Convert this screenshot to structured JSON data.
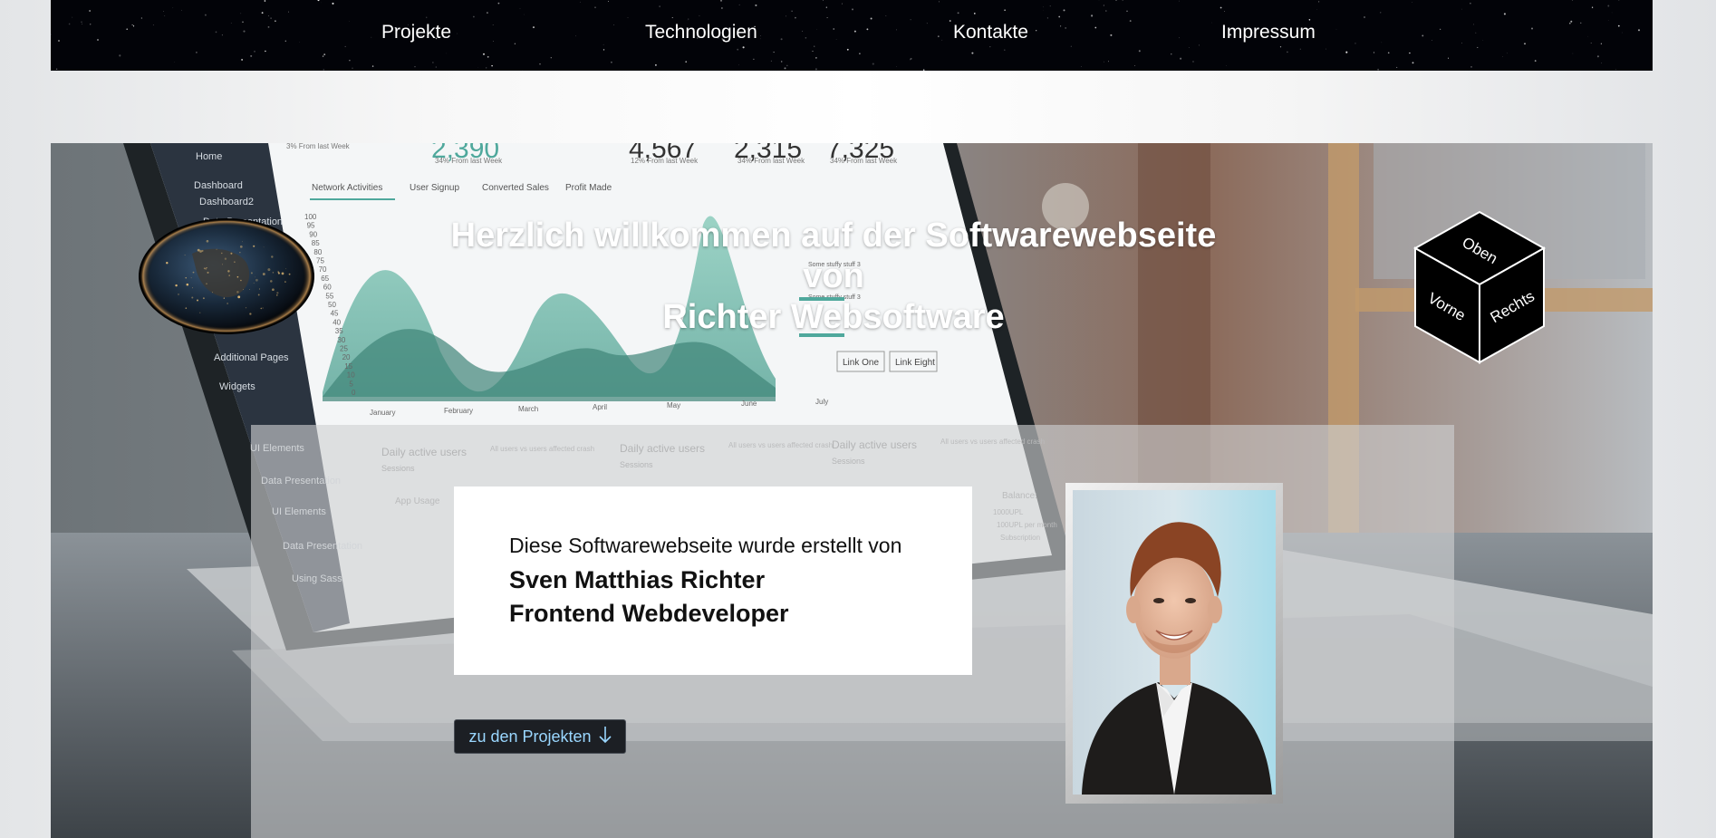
{
  "nav": {
    "items": [
      "Projekte",
      "Technologien",
      "Kontakte",
      "Impressum"
    ]
  },
  "hero": {
    "title_line1": "Herzlich willkommen auf der Softwarewebseite",
    "title_line2": "von",
    "title_line3": "Richter Websoftware",
    "cube_faces": {
      "top": "Oben",
      "front": "Vorne",
      "right": "Rechts"
    }
  },
  "info": {
    "intro": "Diese Softwarewebseite wurde erstellt von",
    "name": "Sven Matthias Richter",
    "role": "Frontend Webdeveloper",
    "button_label": "zu den Projekten"
  },
  "laptop_screen": {
    "stats": [
      "2,390",
      "4,567",
      "2,315",
      "7,325"
    ],
    "stat_notes": [
      "3% From last Week",
      "34% From last Week",
      "12% From last Week",
      "34% From last Week",
      "34% From last Week"
    ],
    "tabs": [
      "Network Activities",
      "User Signup",
      "Converted Sales",
      "Profit Made"
    ],
    "sidebar": [
      "Home",
      "Dashboard",
      "Dashboard2",
      "Data Presentation",
      "Additional Pages",
      "Widgets",
      "UI Elements",
      "Data Presentation",
      "UI Elements",
      "Data Presentation",
      "Using Sass"
    ],
    "months": [
      "January",
      "February",
      "March",
      "April",
      "May",
      "June",
      "July"
    ],
    "y_ticks": [
      "100",
      "95",
      "90",
      "85",
      "80",
      "75",
      "70",
      "65",
      "60",
      "55",
      "50",
      "45",
      "40",
      "35",
      "30",
      "25",
      "20",
      "15",
      "10",
      "5",
      "0"
    ],
    "legend": [
      "Some stuffy stuff 3",
      "Some stuffy stuff 3"
    ],
    "links": [
      "Link One",
      "Link Eight"
    ],
    "widgets": [
      "Daily active users",
      "Daily active users",
      "Daily active users"
    ],
    "widget_sub": [
      "Sessions",
      "Sessions",
      "Sessions"
    ],
    "widget_hint": [
      "All users vs users affected crash",
      "All users vs users affected crash",
      "All users vs users affected crash"
    ],
    "app_label": "App Usage",
    "balance_label": "Balance:",
    "balance_lines": [
      "1000UPL",
      "100UPL per month",
      "Subscription"
    ]
  },
  "colors": {
    "navbar_bg": "#020308",
    "button_bg": "#1c1f24",
    "button_text": "#9ad7ff",
    "accent_teal": "#4fa89c"
  }
}
